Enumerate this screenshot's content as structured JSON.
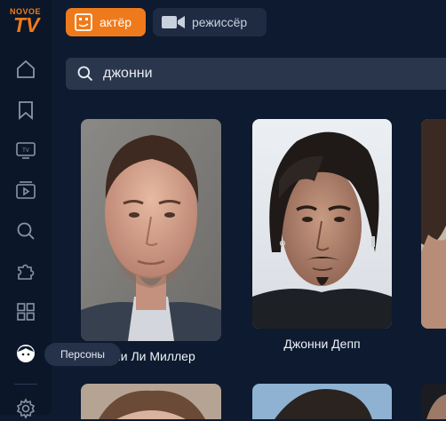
{
  "logo": {
    "top": "NOVOE",
    "main": "TV"
  },
  "tabs": [
    {
      "label": "актёр",
      "icon": "actor-icon",
      "active": true
    },
    {
      "label": "режиссёр",
      "icon": "video-camera-icon",
      "active": false
    }
  ],
  "search": {
    "value": "джонни",
    "icon": "search-icon"
  },
  "sidebar": {
    "items": [
      {
        "name": "home",
        "icon": "home-icon"
      },
      {
        "name": "bookmarks",
        "icon": "bookmark-icon"
      },
      {
        "name": "tv",
        "icon": "tv-icon"
      },
      {
        "name": "media",
        "icon": "play-library-icon"
      },
      {
        "name": "search",
        "icon": "search-icon"
      },
      {
        "name": "extensions",
        "icon": "puzzle-icon"
      },
      {
        "name": "categories",
        "icon": "grid-icon"
      },
      {
        "name": "persons",
        "icon": "face-icon",
        "active": true
      },
      {
        "name": "settings",
        "icon": "gear-icon"
      }
    ],
    "tooltip": "Персоны"
  },
  "results": [
    {
      "name": "Джонни Ли Миллер",
      "visible_name": "нни Ли Миллер"
    },
    {
      "name": "Джонни Депп"
    }
  ],
  "colors": {
    "accent": "#ee7a1c",
    "background": "#0d1a2f",
    "sidebar": "#0b1729"
  }
}
